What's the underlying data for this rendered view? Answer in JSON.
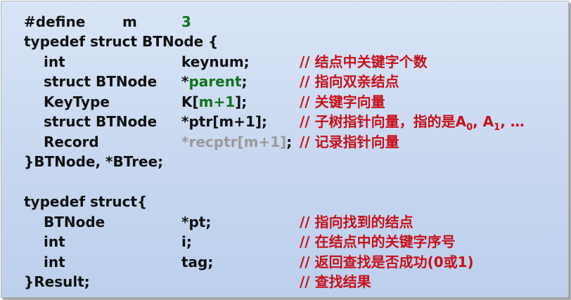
{
  "colors": {
    "comment": "#c8101a",
    "green": "#12731e",
    "gray": "#9a9a9a",
    "text": "#111111",
    "background": "#c8d8f0"
  },
  "lines": [
    {
      "c1": "#define",
      "c1b": "m",
      "c1c": "3"
    },
    {
      "c1": "typedef struct BTNode {"
    },
    {
      "c1": "int",
      "c2": "keynum;",
      "c3": "// 结点中关键字个数"
    },
    {
      "c1": "struct BTNode",
      "c2a": "*",
      "c2b": "parent",
      "c2c": ";",
      "c3": "// 指向双亲结点"
    },
    {
      "c1": "KeyType",
      "c2a": "K[",
      "c2b": "m+1",
      "c2c": "];",
      "c3": "// 关键字向量"
    },
    {
      "c1": "struct BTNode",
      "c2": "*ptr[m+1];",
      "c3a": "// 子树指针向量，指的是A",
      "c3sub0": "0",
      "c3b": ", A",
      "c3sub1": "1",
      "c3c": ", …"
    },
    {
      "c1": "Record",
      "c2a": "*",
      "c2b": "recptr[m+1]",
      "c2c": ";",
      "c3": "// 记录指针向量"
    },
    {
      "c1": "}BTNode, *BTree;"
    },
    {
      "c1": ""
    },
    {
      "c1": "typedef struct{"
    },
    {
      "c1": "BTNode",
      "c2": "*pt;",
      "c3": "// 指向找到的结点"
    },
    {
      "c1": "int",
      "c2": "i;",
      "c3": "// 在结点中的关键字序号"
    },
    {
      "c1": "int",
      "c2": "tag;",
      "c3": "// 返回查找是否成功(0或1)"
    },
    {
      "c1": "}Result;",
      "c3": "// 查找结果"
    }
  ]
}
